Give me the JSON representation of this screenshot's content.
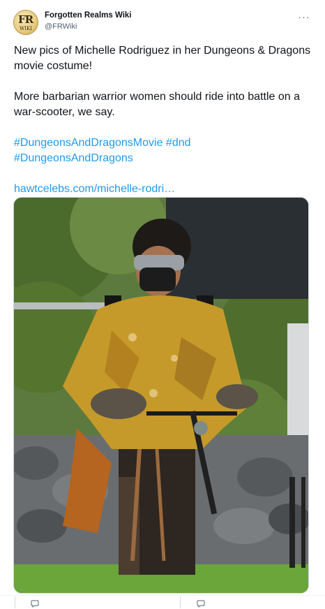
{
  "author": {
    "name": "Forgotten Realms Wiki",
    "handle": "@FRWiki",
    "avatar_logo": "FR"
  },
  "tweet": {
    "line1": "New pics of Michelle Rodriguez in her Dungeons & Dragons movie costume!",
    "line2": "More barbarian warrior women should ride into battle on a war-scooter, we say.",
    "hashtag1": "#DungeonsAndDragonsMovie",
    "hashtag2": "#dnd",
    "hashtag3": "#DungeonsAndDragons",
    "url": "hawtcelebs.com/michelle-rodri…"
  },
  "menu": {
    "more_label": "···"
  },
  "icons": {
    "more": "more-horizontal-icon",
    "reply": "reply-icon",
    "share": "share-icon"
  },
  "colors": {
    "link": "#1d9bf0",
    "text": "#0f1419",
    "secondary": "#536471"
  }
}
